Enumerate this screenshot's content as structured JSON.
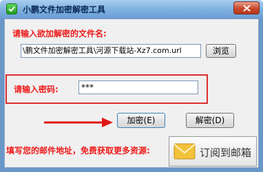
{
  "window": {
    "title": "小鹏文件加密解密工具",
    "close_label": "✕"
  },
  "file_section": {
    "label": "请输入欲加解密的文件名:",
    "path_value": "\\鹏文件加密解密工具\\河源下载站-Xz7.com.url",
    "browse_label": "浏览"
  },
  "password_section": {
    "label": "请输入密码:",
    "value": "***"
  },
  "actions": {
    "encrypt_label": "加密(E)",
    "decrypt_label": "解密(D)"
  },
  "footer": {
    "promo_text": "填写您的邮件地址，免费获取更多资源:",
    "subscribe_label": "订阅到邮箱"
  },
  "colors": {
    "accent_red": "#ee1c1c",
    "titlebar": "#7fb0e0",
    "highlight_border": "#d92f2f"
  },
  "icons": {
    "app": "check-shield-icon",
    "close": "close-icon",
    "arrow": "arrow-right-icon",
    "mail": "envelope-icon"
  }
}
